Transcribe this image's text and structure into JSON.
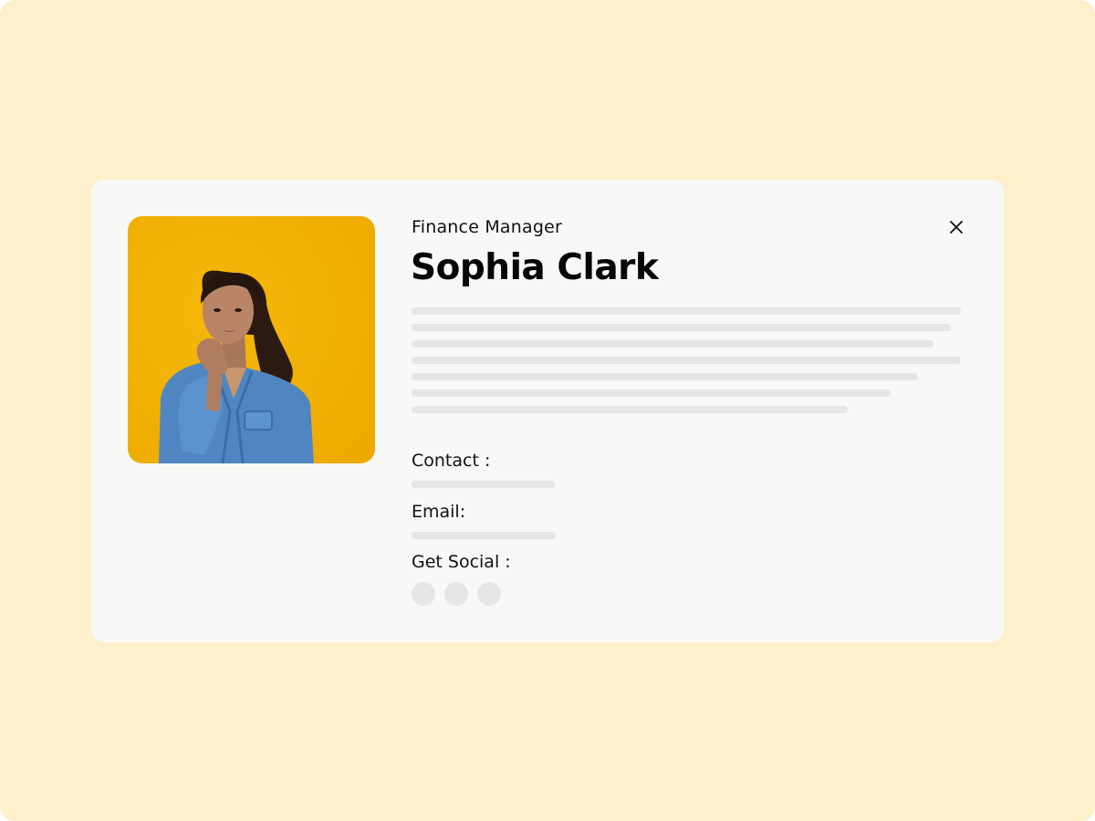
{
  "profile": {
    "role": "Finance Manager",
    "name": "Sophia Clark",
    "photo_icon": "profile-photo",
    "close_icon": "close-icon"
  },
  "bio_placeholder_lines": 7,
  "contact": {
    "label": "Contact :"
  },
  "email": {
    "label": "Email:"
  },
  "social": {
    "label": "Get Social :",
    "icons": [
      "social-icon",
      "social-icon",
      "social-icon"
    ]
  },
  "colors": {
    "background": "#fdf0cb",
    "card": "#f8f8f6",
    "placeholder": "#e6e6e4",
    "photo_backdrop": "#f0b000",
    "text": "#111111"
  }
}
